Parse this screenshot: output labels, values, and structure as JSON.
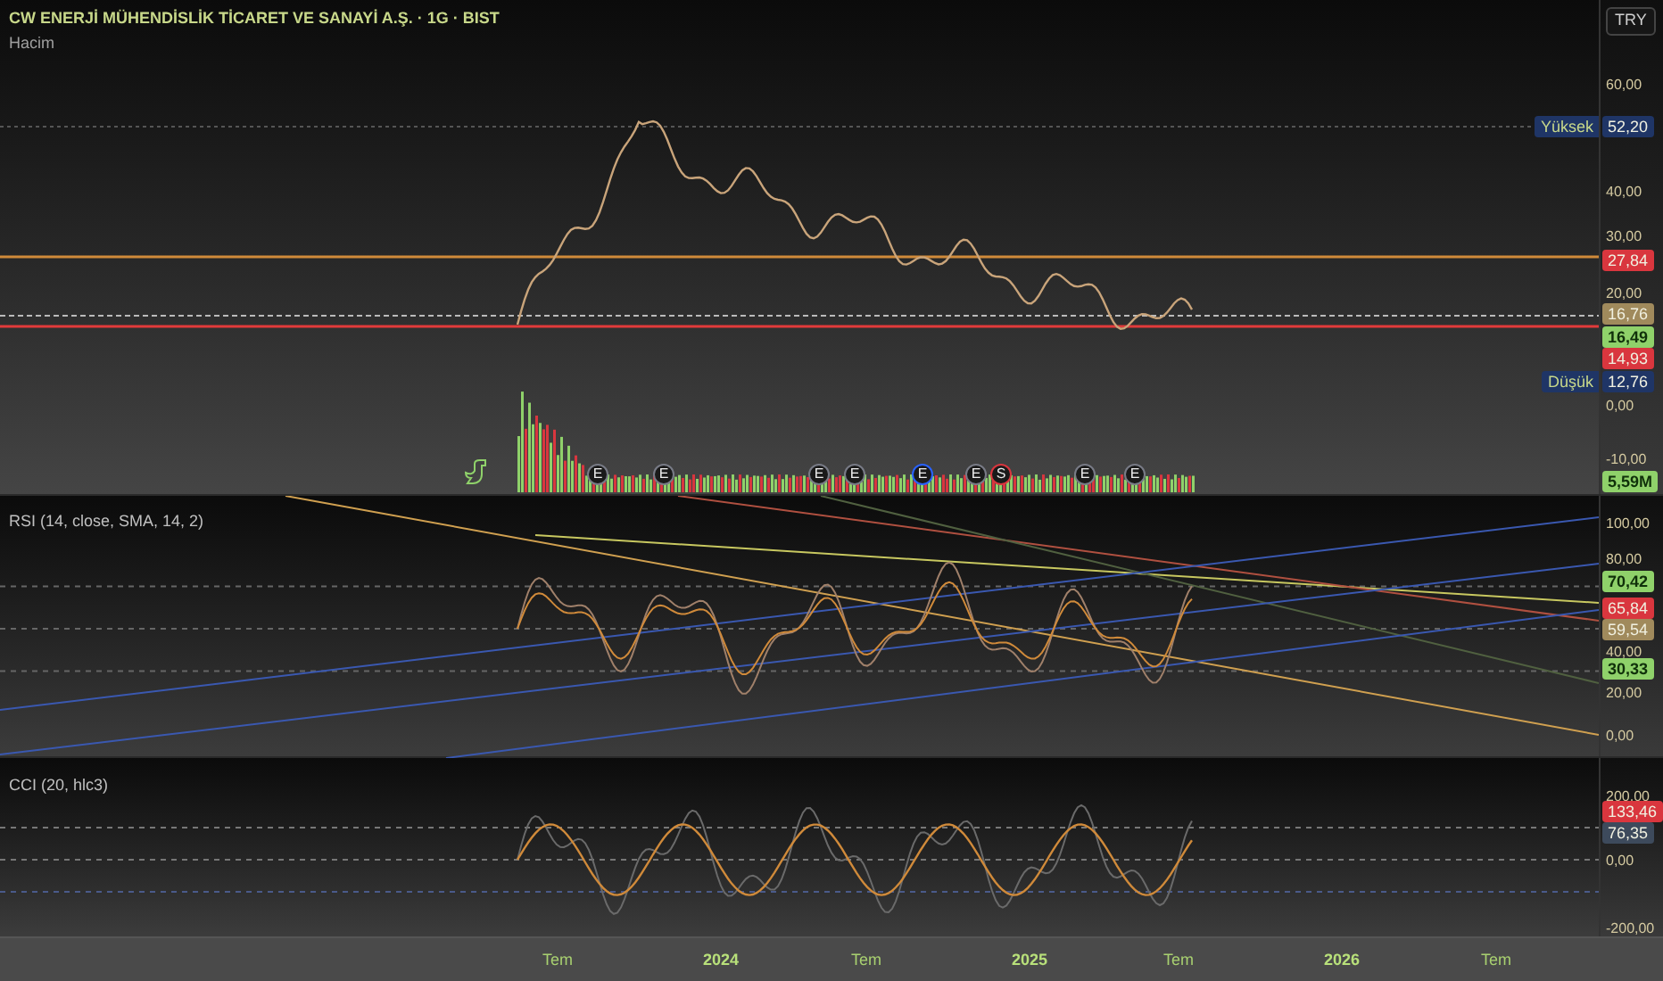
{
  "header": {
    "title": "CW ENERJİ MÜHENDİSLİK TİCARET VE SANAYİ A.Ş. · 1G · BIST",
    "volume_label": "Hacim"
  },
  "currency_button": "TRY",
  "price_panel": {
    "ticks": [
      "60,00",
      "40,00",
      "30,00",
      "20,00",
      "0,00",
      "-10,00"
    ],
    "tags": [
      {
        "caption": "Yüksek",
        "text": "52,20",
        "color": "#1f3566"
      },
      {
        "text": "27,84",
        "color": "#d9363e"
      },
      {
        "text": "16,76",
        "color": "#a08a5c"
      },
      {
        "text": "16,49",
        "color": "#8fd16a"
      },
      {
        "text": "14,93",
        "color": "#d9363e"
      },
      {
        "caption": "Düşük",
        "text": "12,76",
        "color": "#1f3566"
      },
      {
        "text": "5,59M",
        "color": "#8fd16a"
      }
    ],
    "events": [
      {
        "text": "E",
        "color": "#787b86"
      },
      {
        "text": "E",
        "color": "#787b86"
      },
      {
        "text": "E",
        "color": "#787b86"
      },
      {
        "text": "E",
        "color": "#787b86"
      },
      {
        "text": "E",
        "color": "#2962ff"
      },
      {
        "text": "E",
        "color": "#787b86"
      },
      {
        "text": "S",
        "color": "#d9363e"
      },
      {
        "text": "E",
        "color": "#787b86"
      },
      {
        "text": "E",
        "color": "#787b86"
      }
    ]
  },
  "rsi_panel": {
    "title": "RSI (14, close, SMA, 14, 2)",
    "ticks": [
      "100,00",
      "80,00",
      "40,00",
      "20,00",
      "0,00"
    ],
    "tags": [
      {
        "text": "70,42",
        "color": "#8fd16a"
      },
      {
        "text": "65,84",
        "color": "#d9363e"
      },
      {
        "text": "59,54",
        "color": "#a08a5c"
      },
      {
        "text": "30,33",
        "color": "#8fd16a"
      }
    ]
  },
  "cci_panel": {
    "title": "CCI (20, hlc3)",
    "ticks": [
      "200,00",
      "0,00",
      "-200,00"
    ],
    "tags": [
      {
        "text": "133,46",
        "color": "#d9363e"
      },
      {
        "text": "76,35",
        "color": "#3d4a5c"
      }
    ]
  },
  "time_axis": [
    {
      "text": "Tem",
      "kind": "month"
    },
    {
      "text": "2024",
      "kind": "year"
    },
    {
      "text": "Tem",
      "kind": "month"
    },
    {
      "text": "2025",
      "kind": "year"
    },
    {
      "text": "Tem",
      "kind": "month"
    },
    {
      "text": "2026",
      "kind": "year"
    },
    {
      "text": "Tem",
      "kind": "month"
    }
  ]
}
